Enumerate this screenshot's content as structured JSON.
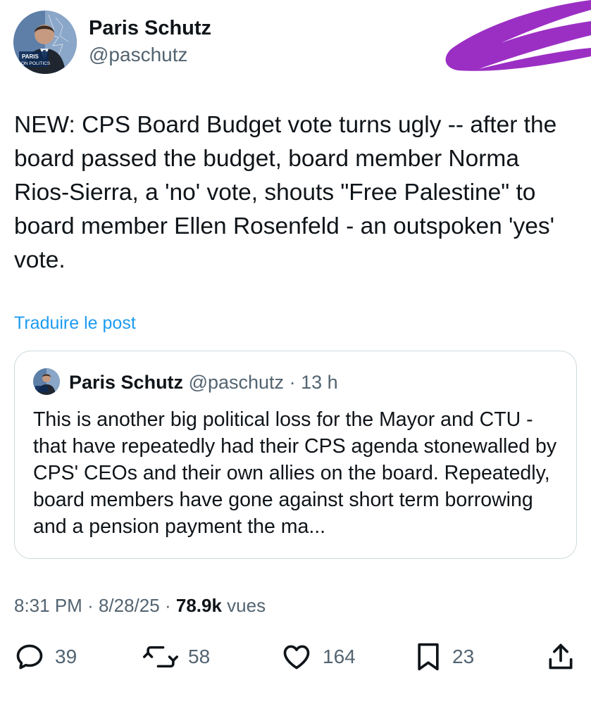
{
  "author": {
    "name": "Paris Schutz",
    "handle": "@paschutz",
    "avatar_badge_line1": "PARIS",
    "avatar_badge_line2": "ON POLITICS"
  },
  "post": {
    "text": "NEW: CPS Board Budget vote turns ugly -- after the board passed the budget, board member Norma Rios-Sierra, a 'no' vote, shouts \"Free Palestine\" to board member Ellen Rosenfeld - an outspoken 'yes' vote.",
    "translate_label": "Traduire le post"
  },
  "quote": {
    "name": "Paris Schutz",
    "handle": "@paschutz",
    "separator": "·",
    "time": "13 h",
    "text": "This is another big political loss for the Mayor and CTU - that have repeatedly had their CPS agenda stonewalled by CPS' CEOs and their own allies on the board. Repeatedly, board members have gone against short term borrowing and a pension payment the ma..."
  },
  "meta": {
    "time": "8:31 PM",
    "date": "8/28/25",
    "views_count": "78.9k",
    "views_label": "vues",
    "separator": "·"
  },
  "actions": {
    "replies": "39",
    "reposts": "58",
    "likes": "164",
    "bookmarks": "23",
    "icons": [
      "reply-icon",
      "repost-icon",
      "like-icon",
      "bookmark-icon",
      "share-icon"
    ]
  },
  "colors": {
    "scribble": "#9b2fc4",
    "link": "#1d9bf0",
    "secondary_text": "#536471",
    "border": "#cfd9de"
  }
}
